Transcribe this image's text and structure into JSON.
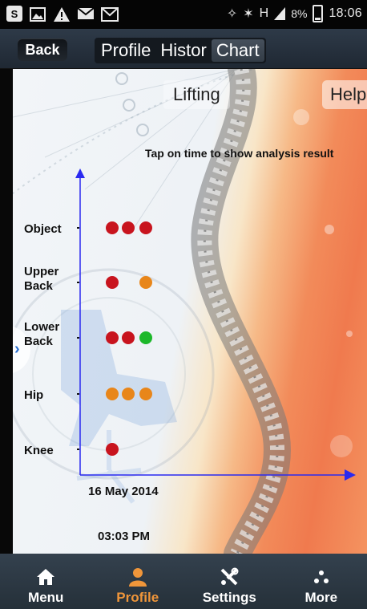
{
  "status_bar": {
    "time": "18:06",
    "battery": "8%",
    "signal_glyph": "H",
    "left_icons": [
      "notification-s-icon",
      "image-icon",
      "warning-icon",
      "message-icon",
      "gmail-icon"
    ]
  },
  "header": {
    "back_label": "Back",
    "tabs": [
      {
        "label": "Profile",
        "active": false
      },
      {
        "label": "Histor",
        "active": false
      },
      {
        "label": "Chart",
        "active": true
      }
    ]
  },
  "content": {
    "lifting_label": "Lifting",
    "help_label": "Help",
    "hint": "Tap on time to show analysis result"
  },
  "chart_data": {
    "type": "scatter",
    "categories": [
      "Object",
      "Upper\nBack",
      "Lower\nBack",
      "Hip",
      "Knee"
    ],
    "x": [
      "16 May 2014",
      "03:03 PM"
    ],
    "series": [
      {
        "category": "Object",
        "dots": [
          "red",
          "red",
          "red"
        ]
      },
      {
        "category": "Upper Back",
        "dots": [
          "red",
          null,
          "orange"
        ]
      },
      {
        "category": "Lower Back",
        "dots": [
          "red",
          "red",
          "green"
        ]
      },
      {
        "category": "Hip",
        "dots": [
          "orange",
          "orange",
          "orange"
        ]
      },
      {
        "category": "Knee",
        "dots": [
          "red",
          null,
          null
        ]
      }
    ],
    "colors": {
      "red": "#c8141e",
      "orange": "#e8861a",
      "green": "#1cb82a",
      "axis": "#2a2af0"
    }
  },
  "bottom_nav": [
    {
      "label": "Menu",
      "icon": "home-icon",
      "active": false
    },
    {
      "label": "Profile",
      "icon": "person-icon",
      "active": true
    },
    {
      "label": "Settings",
      "icon": "tools-icon",
      "active": false
    },
    {
      "label": "More",
      "icon": "more-dots-icon",
      "active": false
    }
  ]
}
